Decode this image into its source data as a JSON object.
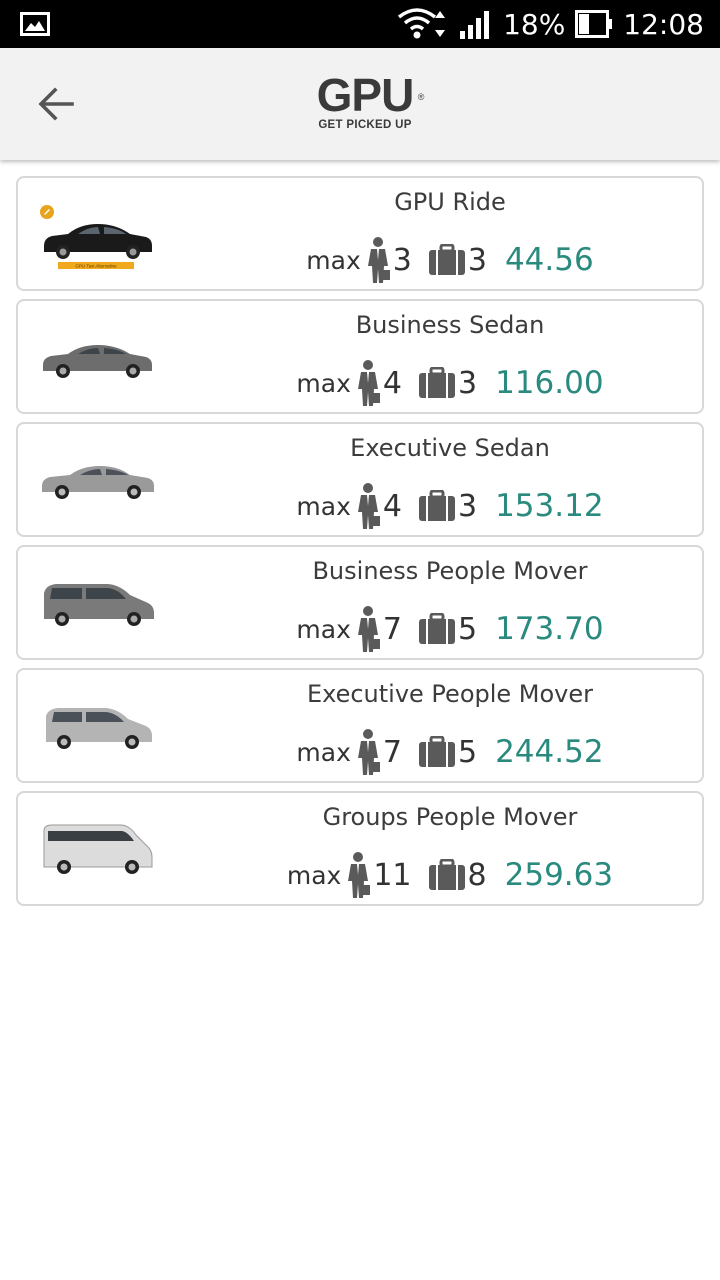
{
  "status_bar": {
    "battery": "18%",
    "time": "12:08"
  },
  "app_bar": {
    "logo_text": "GPU",
    "logo_reg": "®",
    "logo_tagline": "GET PICKED UP"
  },
  "vehicles": [
    {
      "name": "GPU Ride",
      "max_label": "max",
      "passengers": "3",
      "bags": "3",
      "price": "44.56",
      "badge_text": "GPU Taxi Alternative"
    },
    {
      "name": "Business Sedan",
      "max_label": "max",
      "passengers": "4",
      "bags": "3",
      "price": "116.00"
    },
    {
      "name": "Executive Sedan",
      "max_label": "max",
      "passengers": "4",
      "bags": "3",
      "price": "153.12"
    },
    {
      "name": "Business People Mover",
      "max_label": "max",
      "passengers": "7",
      "bags": "5",
      "price": "173.70"
    },
    {
      "name": "Executive People Mover",
      "max_label": "max",
      "passengers": "7",
      "bags": "5",
      "price": "244.52"
    },
    {
      "name": "Groups People Mover",
      "max_label": "max",
      "passengers": "11",
      "bags": "8",
      "price": "259.63"
    }
  ],
  "colors": {
    "price": "#2a8a7e",
    "card_border": "#d8d8d8",
    "app_bar": "#f2f2f2"
  }
}
